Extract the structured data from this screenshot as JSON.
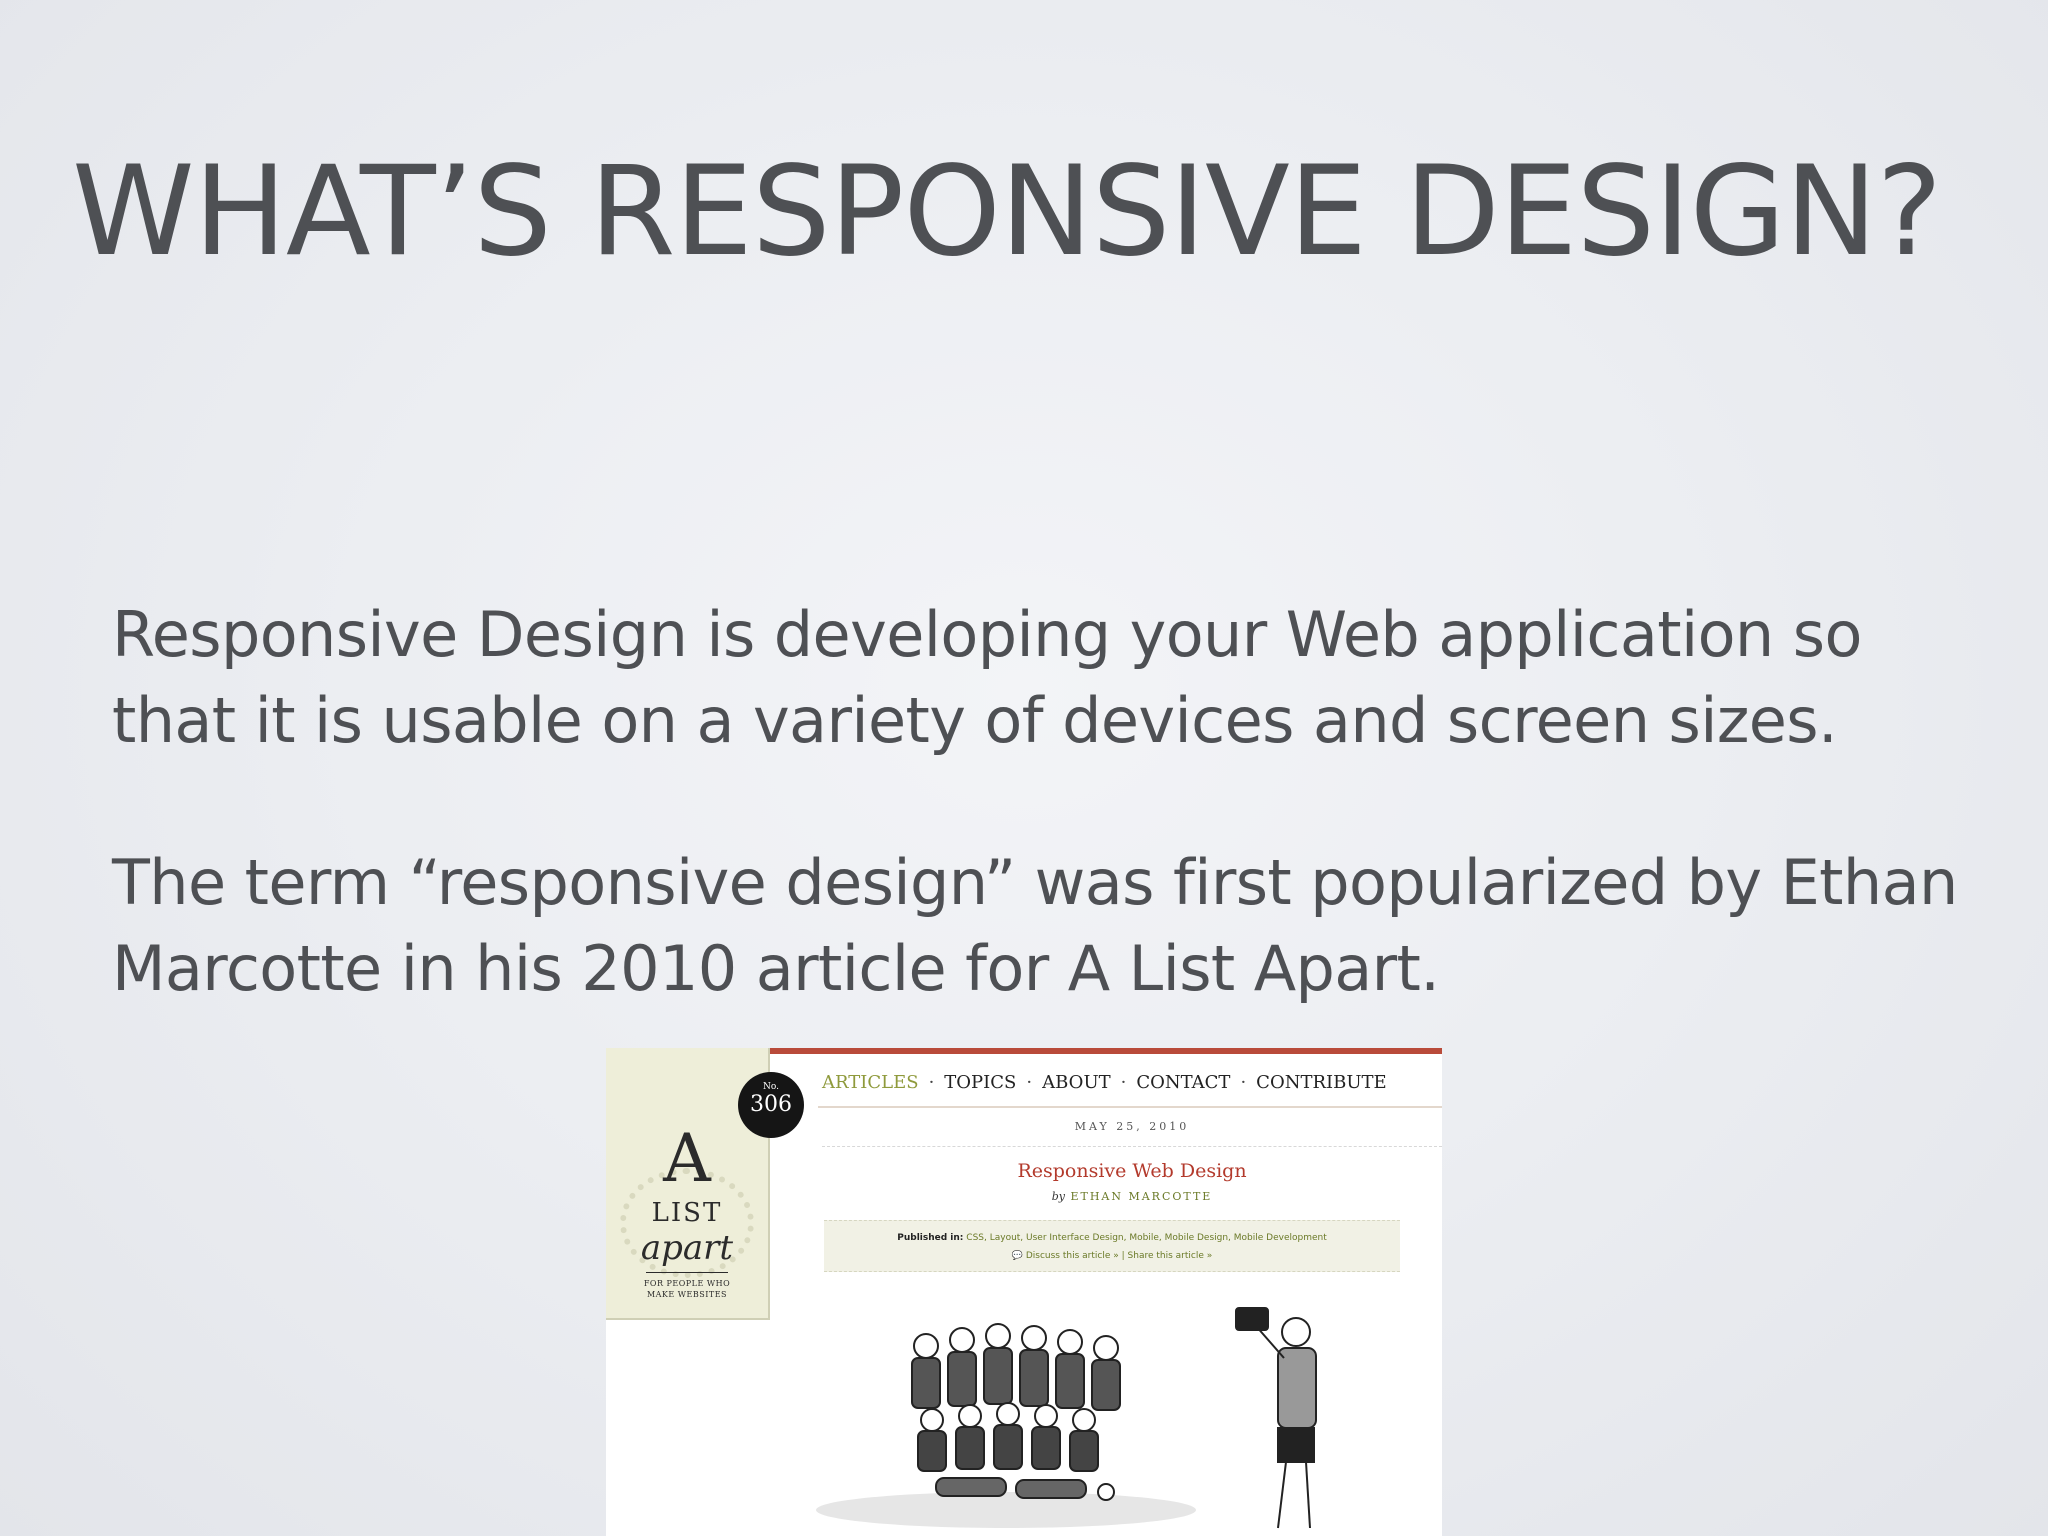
{
  "slide": {
    "title": "WHAT’S RESPONSIVE DESIGN?",
    "paragraphs": [
      "Responsive Design is developing your Web application so that it is usable on a variety of devices and screen sizes.",
      "The term “responsive design” was first popularized by Ethan Marcotte in his 2010 article for A List Apart."
    ]
  },
  "screenshot": {
    "issue_label": "No.",
    "issue_number": "306",
    "logo": {
      "a": "A",
      "list": "LIST",
      "apart": "apart",
      "tagline": "FOR PEOPLE WHO MAKE WEBSITES"
    },
    "nav": [
      "ARTICLES",
      "TOPICS",
      "ABOUT",
      "CONTACT",
      "CONTRIBUTE"
    ],
    "nav_separator": "·",
    "date": "MAY 25, 2010",
    "headline": "Responsive Web Design",
    "byline_prefix": "by",
    "author": "ETHAN MARCOTTE",
    "published_label": "Published in:",
    "published_tags": "CSS, Layout, User Interface Design, Mobile, Mobile Design, Mobile Development",
    "discuss_link": "Discuss this article »",
    "link_separator": "|",
    "share_link": "Share this article »"
  },
  "colors": {
    "background": "#eceef2",
    "text": "#4e5054",
    "ala_red": "#b33a2c",
    "ala_green": "#8f9a3c",
    "ala_logo_bg": "#eeeed9"
  }
}
